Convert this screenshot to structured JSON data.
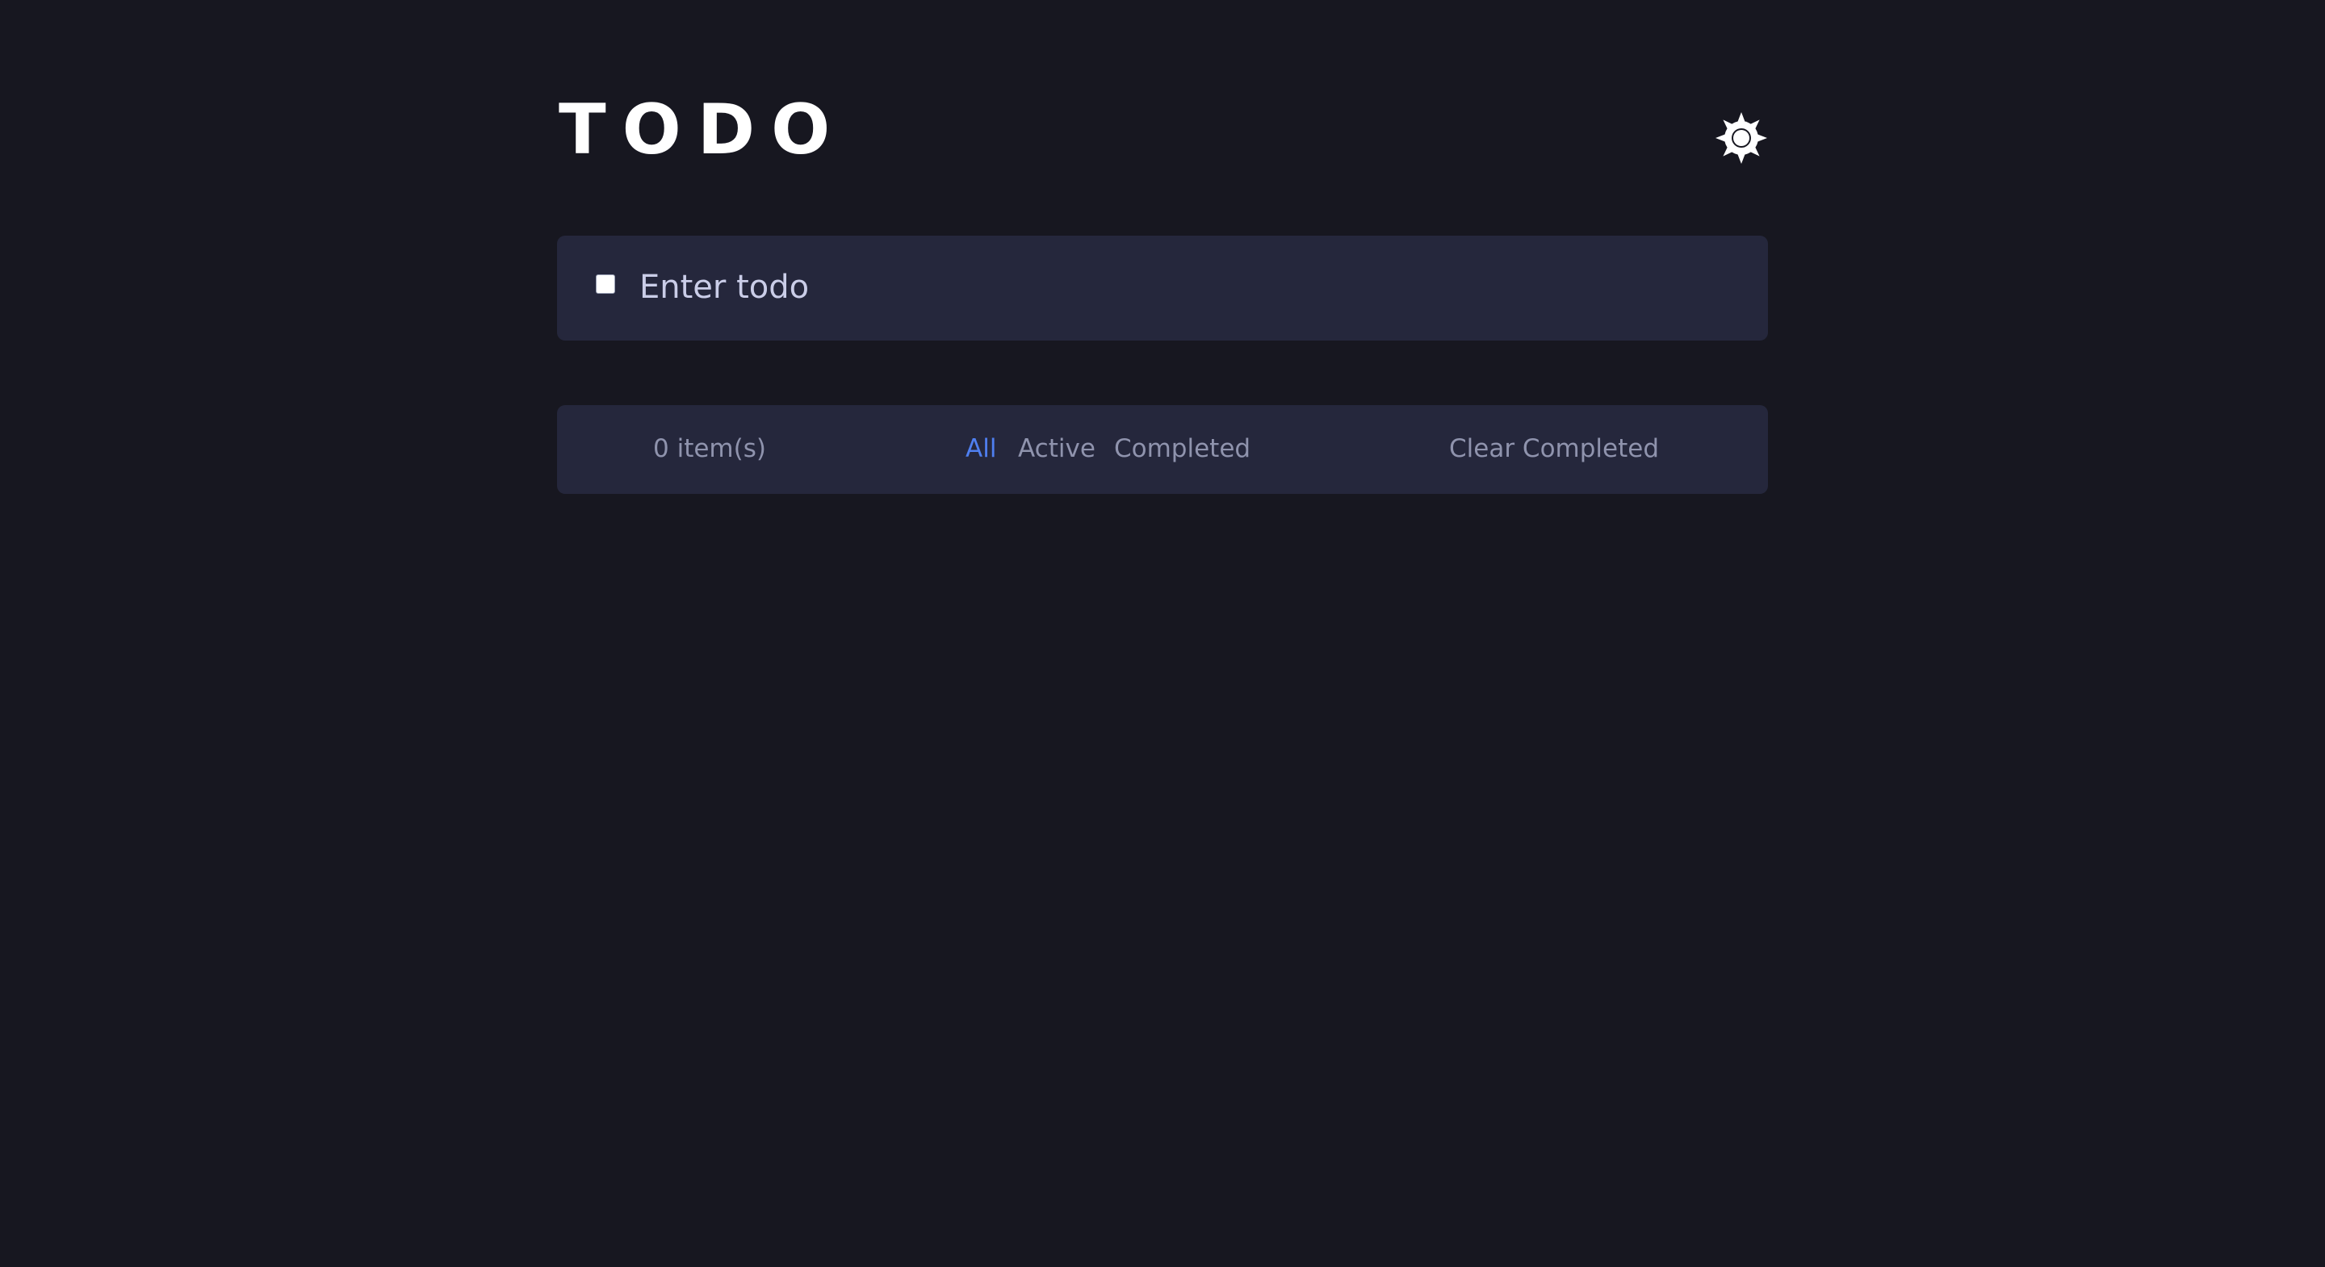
{
  "header": {
    "title": "TODO",
    "theme_icon": "sun-icon"
  },
  "input": {
    "placeholder": "Enter todo",
    "value": ""
  },
  "footer": {
    "items_left": "0 item(s)",
    "filters": [
      {
        "label": "All",
        "active": true
      },
      {
        "label": "Active",
        "active": false
      },
      {
        "label": "Completed",
        "active": false
      }
    ],
    "clear_label": "Clear Completed"
  },
  "colors": {
    "background": "#171720",
    "card": "#25273c",
    "accent": "#4f7ff0",
    "muted_text": "#8f93ad",
    "input_text": "#cacde8"
  }
}
